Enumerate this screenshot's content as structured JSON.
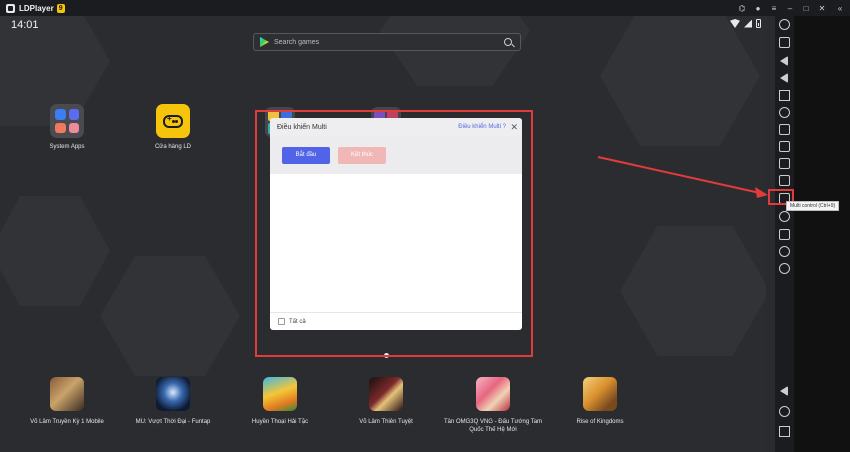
{
  "window": {
    "title": "LDPlayer",
    "version": "9"
  },
  "status": {
    "time": "14:01"
  },
  "search": {
    "placeholder": "Search games"
  },
  "desktop": {
    "apps": [
      {
        "label": "System Apps"
      },
      {
        "label": "Cửa hàng LD"
      }
    ]
  },
  "dialog": {
    "title": "Điều khiển Multi",
    "help_link": "Điều khiển Multi ?",
    "close": "✕",
    "start_label": "Bắt đầu",
    "end_label": "Kết thúc",
    "select_all_label": "Tất cả"
  },
  "dock": {
    "apps": [
      {
        "label": "Võ Lâm Truyền Kỳ 1 Mobile"
      },
      {
        "label": "MU: Vượt Thời Đại - Funtap"
      },
      {
        "label": "Huyền Thoại Hải Tặc"
      },
      {
        "label": "Võ Lâm Thiên Tuyệt"
      },
      {
        "label": "Tân OMG3Q VNG - Đấu Tướng Tam Quốc Thế Hệ Mới"
      },
      {
        "label": "Rise of Kingdoms"
      }
    ]
  },
  "sidebar": {
    "tooltip": "Multi control (Ctrl+9)"
  },
  "colors": {
    "accent": "#5163e6",
    "highlight": "#e33b3b",
    "brand_yellow": "#f6c40a"
  },
  "icons": [
    "gamepad-icon",
    "user-icon",
    "menu-icon",
    "minimize-icon",
    "maximize-icon",
    "close-icon",
    "collapse-icon",
    "wifi-icon",
    "signal-icon",
    "battery-icon",
    "search-icon",
    "play-store-icon"
  ]
}
